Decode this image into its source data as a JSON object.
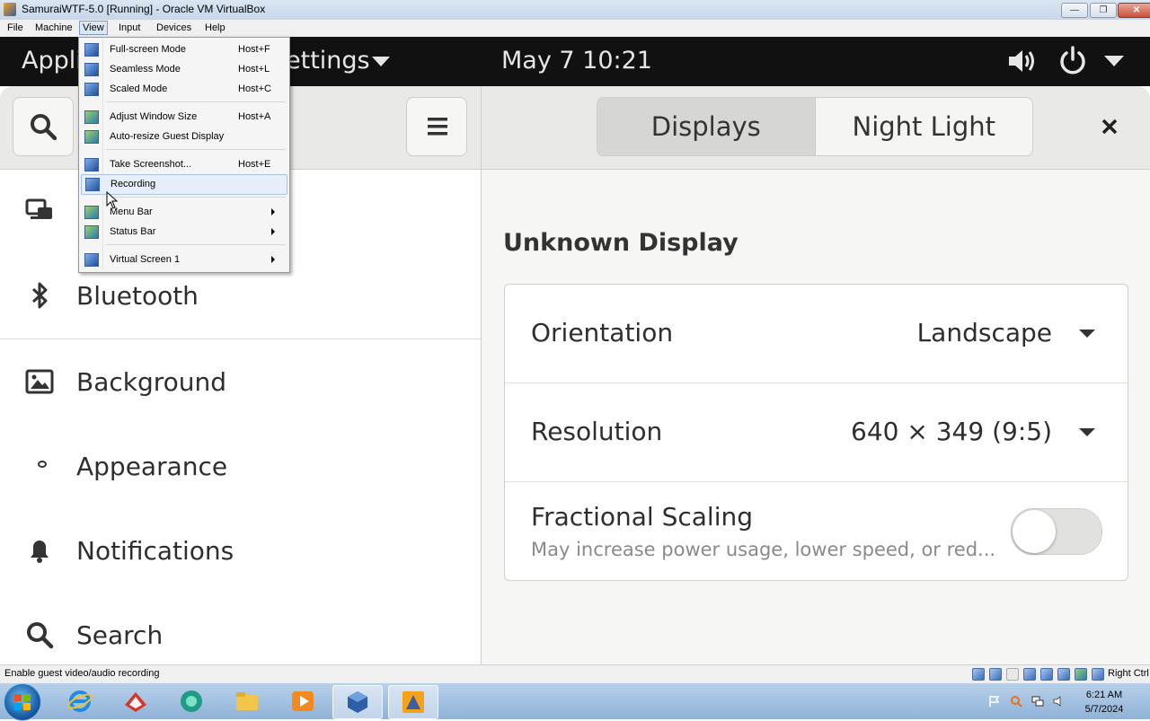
{
  "window": {
    "title": "SamuraiWTF-5.0 [Running] - Oracle VM VirtualBox",
    "controls": [
      "minimize-icon",
      "restore-icon",
      "close-icon"
    ]
  },
  "vbox_menu": [
    "File",
    "Machine",
    "View",
    "Input",
    "Devices",
    "Help"
  ],
  "view_menu": [
    {
      "label": "Full-screen Mode",
      "shortcut": "Host+F",
      "icon": "fullscreen-icon"
    },
    {
      "label": "Seamless Mode",
      "shortcut": "Host+L",
      "icon": "seamless-icon"
    },
    {
      "label": "Scaled Mode",
      "shortcut": "Host+C",
      "icon": "scaled-icon"
    },
    {
      "label": "Adjust Window Size",
      "shortcut": "Host+A",
      "icon": "adjust-window-icon"
    },
    {
      "label": "Auto-resize Guest Display",
      "shortcut": "",
      "icon": "auto-resize-icon"
    },
    {
      "label": "Take Screenshot...",
      "shortcut": "Host+E",
      "icon": "screenshot-icon"
    },
    {
      "label": "Recording",
      "shortcut": "",
      "icon": "recording-icon"
    },
    {
      "label": "Menu Bar",
      "shortcut": "",
      "icon": "menu-bar-icon"
    },
    {
      "label": "Status Bar",
      "shortcut": "",
      "icon": "status-bar-icon"
    },
    {
      "label": "Virtual Screen 1",
      "shortcut": "",
      "icon": "virtual-screen-icon"
    }
  ],
  "gnome": {
    "activities": "Appli",
    "app_menu": "ettings",
    "clock": "May 7  10:21",
    "tray_icons": [
      "volume-icon",
      "power-icon",
      "caret-down-icon"
    ]
  },
  "settings": {
    "sidebar": [
      {
        "label": "",
        "icon": "network-icon"
      },
      {
        "label": "Bluetooth",
        "icon": "bluetooth-icon"
      },
      {
        "label": "Background",
        "icon": "background-icon"
      },
      {
        "label": "Appearance",
        "icon": "appearance-icon"
      },
      {
        "label": "Notifications",
        "icon": "bell-icon"
      },
      {
        "label": "Search",
        "icon": "search-icon"
      }
    ],
    "tabs": [
      "Displays",
      "Night Light"
    ],
    "display_title": "Unknown Display",
    "rows": {
      "orientation": {
        "label": "Orientation",
        "value": "Landscape"
      },
      "resolution": {
        "label": "Resolution",
        "value": "640 × 349 (9:5)"
      },
      "scaling": {
        "label": "Fractional Scaling",
        "desc": "May increase power usage, lower speed, or red...",
        "enabled": false
      }
    }
  },
  "statusbar": {
    "text": "Enable guest video/audio recording",
    "host_key": "Right Ctrl"
  },
  "taskbar": {
    "apps": [
      "ie-icon",
      "gitkraken-icon",
      "app-icon",
      "folder-icon",
      "media-player-icon",
      "virtualbox-icon",
      "virtualbox-vm-icon"
    ],
    "time": "6:21 AM",
    "date": "5/7/2024"
  }
}
